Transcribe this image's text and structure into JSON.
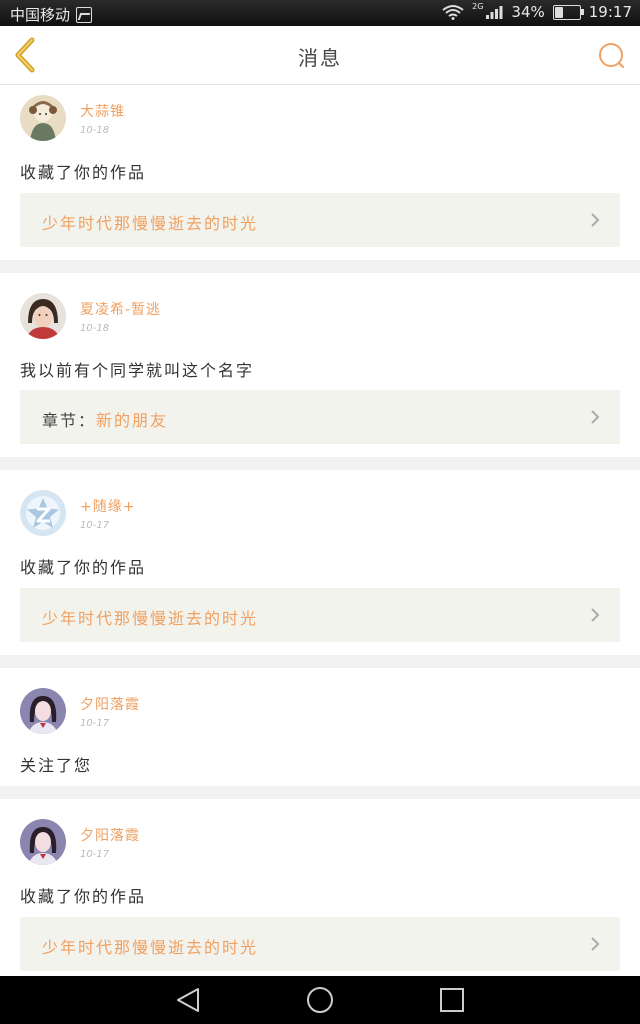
{
  "status_bar": {
    "carrier": "中国移动",
    "network": "2G",
    "battery": "34%",
    "battery_level": 0.34,
    "time": "19:17"
  },
  "header": {
    "title": "消息"
  },
  "messages": [
    {
      "user": "大蒜锥",
      "time": "10-18",
      "text": "收藏了你的作品",
      "quote_label": "",
      "quote": "少年时代那慢慢逝去的时光"
    },
    {
      "user": "夏凌希-暂逃",
      "time": "10-18",
      "text": "我以前有个同学就叫这个名字",
      "quote_label": "章节：",
      "quote": "新的朋友"
    },
    {
      "user": "+随缘+",
      "time": "10-17",
      "text": "收藏了你的作品",
      "quote_label": "",
      "quote": "少年时代那慢慢逝去的时光"
    },
    {
      "user": "夕阳落霞",
      "time": "10-17",
      "text": "关注了您"
    },
    {
      "user": "夕阳落霞",
      "time": "10-17",
      "text": "收藏了你的作品",
      "quote_label": "",
      "quote": "少年时代那慢慢逝去的时光"
    }
  ],
  "colors": {
    "accent": "#f0a060",
    "back_arrow": "#d4a12a",
    "quote_bg": "#f3f3ee"
  },
  "icons": {
    "back": "back-arrow-icon",
    "search": "search-icon",
    "chevron": "chevron-right-icon",
    "nav_back": "triangle-back-icon",
    "nav_home": "circle-home-icon",
    "nav_recent": "square-recent-icon"
  }
}
